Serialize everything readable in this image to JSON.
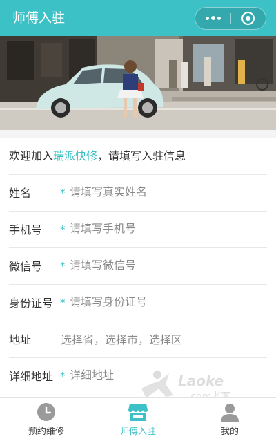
{
  "nav": {
    "title": "师傅入驻"
  },
  "colors": {
    "accent": "#3bc1c6",
    "placeholder": "#8a8a8a",
    "required_star": "#3bc1c6"
  },
  "banner": {
    "icon": "street-photo-banner"
  },
  "form": {
    "welcome_prefix": "欢迎加入",
    "welcome_brand": "瑞派快修",
    "welcome_suffix": "，请填写入驻信息",
    "required_mark": "*",
    "fields": [
      {
        "label": "姓名",
        "placeholder": "请填写真实姓名",
        "required": true
      },
      {
        "label": "手机号",
        "placeholder": "请填写手机号",
        "required": true
      },
      {
        "label": "微信号",
        "placeholder": "请填写微信号",
        "required": true
      },
      {
        "label": "身份证号",
        "placeholder": "请填写身份证号",
        "required": true
      },
      {
        "label": "地址",
        "placeholder": "选择省，选择市，选择区",
        "required": false
      },
      {
        "label": "详细地址",
        "placeholder": "详细地址",
        "required": true
      }
    ]
  },
  "watermark": {
    "text": "Laoke",
    "subtext": ".com老客"
  },
  "tabbar": {
    "items": [
      {
        "label": "预约维修",
        "icon": "clock-icon",
        "active": false
      },
      {
        "label": "师傅入驻",
        "icon": "storefront-icon",
        "active": true
      },
      {
        "label": "我的",
        "icon": "user-icon",
        "active": false
      }
    ]
  }
}
